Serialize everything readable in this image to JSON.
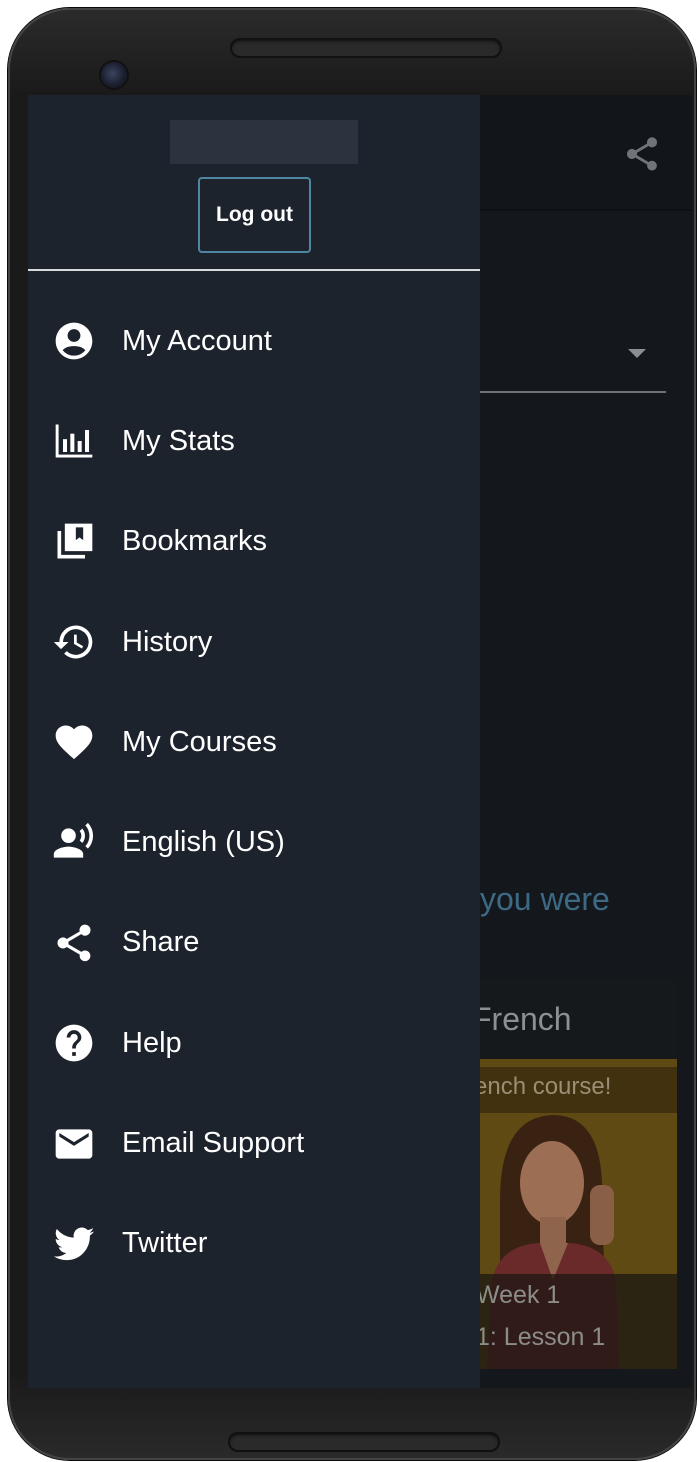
{
  "drawer": {
    "logout_label": "Log out",
    "items": [
      {
        "icon": "account-circle-icon",
        "label": "My Account"
      },
      {
        "icon": "bar-chart-icon",
        "label": "My Stats"
      },
      {
        "icon": "bookmarks-icon",
        "label": "Bookmarks"
      },
      {
        "icon": "history-icon",
        "label": "History"
      },
      {
        "icon": "heart-icon",
        "label": "My Courses"
      },
      {
        "icon": "voice-language-icon",
        "label": "English (US)"
      },
      {
        "icon": "share-icon",
        "label": "Share"
      },
      {
        "icon": "help-icon",
        "label": "Help"
      },
      {
        "icon": "email-icon",
        "label": "Email Support"
      },
      {
        "icon": "twitter-icon",
        "label": "Twitter"
      }
    ]
  },
  "background": {
    "prompt_text_fragment": "you were",
    "course": {
      "title_fragment": "French",
      "subtitle_fragment": "ench course!",
      "week_label": "Week 1",
      "lesson_label": "1: Lesson 1"
    }
  },
  "colors": {
    "drawer_bg": "#1d232c",
    "logout_border": "#4f87a3",
    "screen_bg": "#14181d"
  }
}
